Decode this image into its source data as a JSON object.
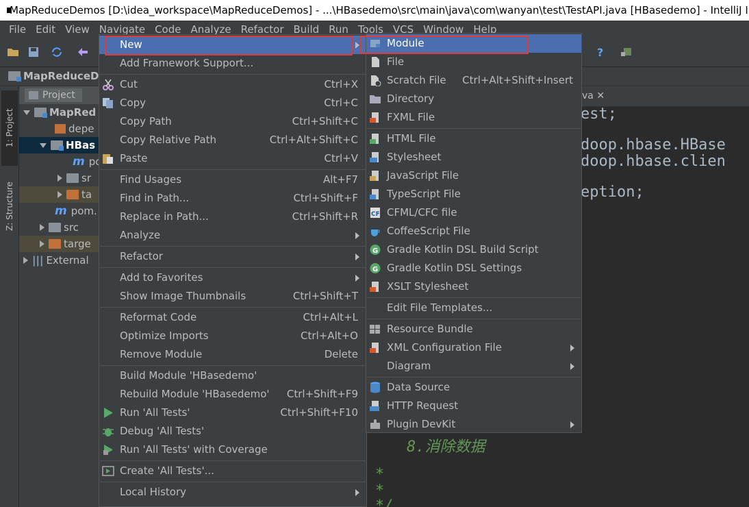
{
  "window": {
    "title": "MapReduceDemos [D:\\idea_workspace\\MapReduceDemos] - ...\\HBasedemo\\src\\main\\java\\com\\wanyan\\test\\TestAPI.java [HBasedemo] - IntelliJ IDEA"
  },
  "menubar": [
    "File",
    "Edit",
    "View",
    "Navigate",
    "Code",
    "Analyze",
    "Refactor",
    "Build",
    "Run",
    "Tools",
    "VCS",
    "Window",
    "Help"
  ],
  "navbar": {
    "crumb": "MapReduceDe"
  },
  "tool_windows": {
    "project": "1: Project",
    "structure": "Z: Structure"
  },
  "project_panel": {
    "header": "Project",
    "rows": [
      "MapRed",
      "depe",
      "HBas",
      "po",
      "sr",
      "ta",
      "pom.",
      "src",
      "targe",
      "External"
    ]
  },
  "editor": {
    "tab": "va",
    "lines": [
      "est;",
      "doop.hbase.HBase",
      "doop.hbase.clien",
      "eption;",
      "8.消除数据",
      "*",
      "*",
      "*/"
    ]
  },
  "context_menu": [
    {
      "label": "New",
      "shortcut": "",
      "submenu": true,
      "icon": "none"
    },
    {
      "label": "Add Framework Support...",
      "shortcut": ""
    },
    {
      "label": "Cut",
      "shortcut": "Ctrl+X",
      "icon": "scissors-icon"
    },
    {
      "label": "Copy",
      "shortcut": "Ctrl+C",
      "icon": "copy-icon"
    },
    {
      "label": "Copy Path",
      "shortcut": "Ctrl+Shift+C"
    },
    {
      "label": "Copy Relative Path",
      "shortcut": "Ctrl+Alt+Shift+C"
    },
    {
      "label": "Paste",
      "shortcut": "Ctrl+V",
      "icon": "paste-icon"
    },
    {
      "label": "Find Usages",
      "shortcut": "Alt+F7"
    },
    {
      "label": "Find in Path...",
      "shortcut": "Ctrl+Shift+F"
    },
    {
      "label": "Replace in Path...",
      "shortcut": "Ctrl+Shift+R"
    },
    {
      "label": "Analyze",
      "shortcut": "",
      "submenu": true
    },
    {
      "label": "Refactor",
      "shortcut": "",
      "submenu": true
    },
    {
      "label": "Add to Favorites",
      "shortcut": "",
      "submenu": true
    },
    {
      "label": "Show Image Thumbnails",
      "shortcut": "Ctrl+Shift+T"
    },
    {
      "label": "Reformat Code",
      "shortcut": "Ctrl+Alt+L"
    },
    {
      "label": "Optimize Imports",
      "shortcut": "Ctrl+Alt+O"
    },
    {
      "label": "Remove Module",
      "shortcut": "Delete"
    },
    {
      "label": "Build Module 'HBasedemo'",
      "shortcut": ""
    },
    {
      "label": "Rebuild Module 'HBasedemo'",
      "shortcut": "Ctrl+Shift+F9"
    },
    {
      "label": "Run 'All Tests'",
      "shortcut": "Ctrl+Shift+F10",
      "icon": "run-icon"
    },
    {
      "label": "Debug 'All Tests'",
      "shortcut": "",
      "icon": "debug-icon"
    },
    {
      "label": "Run 'All Tests' with Coverage",
      "shortcut": "",
      "icon": "coverage-icon"
    },
    {
      "label": "Create 'All Tests'...",
      "shortcut": "",
      "icon": "test-config-icon"
    },
    {
      "label": "Local History",
      "shortcut": "",
      "submenu": true
    }
  ],
  "new_submenu": [
    {
      "label": "Module",
      "shortcut": "",
      "icon": "module-icon"
    },
    {
      "label": "File",
      "shortcut": "",
      "icon": "file-icon"
    },
    {
      "label": "Scratch File",
      "shortcut": "Ctrl+Alt+Shift+Insert",
      "icon": "scratch-file-icon"
    },
    {
      "label": "Directory",
      "shortcut": "",
      "icon": "directory-icon"
    },
    {
      "label": "FXML File",
      "shortcut": "",
      "icon": "fxml-icon"
    },
    {
      "label": "HTML File",
      "shortcut": "",
      "icon": "html-icon"
    },
    {
      "label": "Stylesheet",
      "shortcut": "",
      "icon": "css-icon"
    },
    {
      "label": "JavaScript File",
      "shortcut": "",
      "icon": "js-icon"
    },
    {
      "label": "TypeScript File",
      "shortcut": "",
      "icon": "ts-icon"
    },
    {
      "label": "CFML/CFC file",
      "shortcut": "",
      "icon": "cf-icon"
    },
    {
      "label": "CoffeeScript File",
      "shortcut": "",
      "icon": "coffee-icon"
    },
    {
      "label": "Gradle Kotlin DSL Build Script",
      "shortcut": "",
      "icon": "gradle-icon"
    },
    {
      "label": "Gradle Kotlin DSL Settings",
      "shortcut": "",
      "icon": "gradle-icon"
    },
    {
      "label": "XSLT Stylesheet",
      "shortcut": "",
      "icon": "xslt-icon"
    },
    {
      "label": "Edit File Templates...",
      "shortcut": ""
    },
    {
      "label": "Resource Bundle",
      "shortcut": "",
      "icon": "resource-bundle-icon"
    },
    {
      "label": "XML Configuration File",
      "shortcut": "",
      "submenu": true,
      "icon": "xml-icon"
    },
    {
      "label": "Diagram",
      "shortcut": "",
      "submenu": true
    },
    {
      "label": "Data Source",
      "shortcut": "",
      "icon": "database-icon"
    },
    {
      "label": "HTTP Request",
      "shortcut": "",
      "icon": "api-icon"
    },
    {
      "label": "Plugin DevKit",
      "shortcut": "",
      "submenu": true,
      "icon": "plugin-icon"
    }
  ],
  "colors": {
    "highlight": "#4b6eaf",
    "annotation_box": "#e03b3b",
    "menu_bg": "#3c3f41"
  }
}
